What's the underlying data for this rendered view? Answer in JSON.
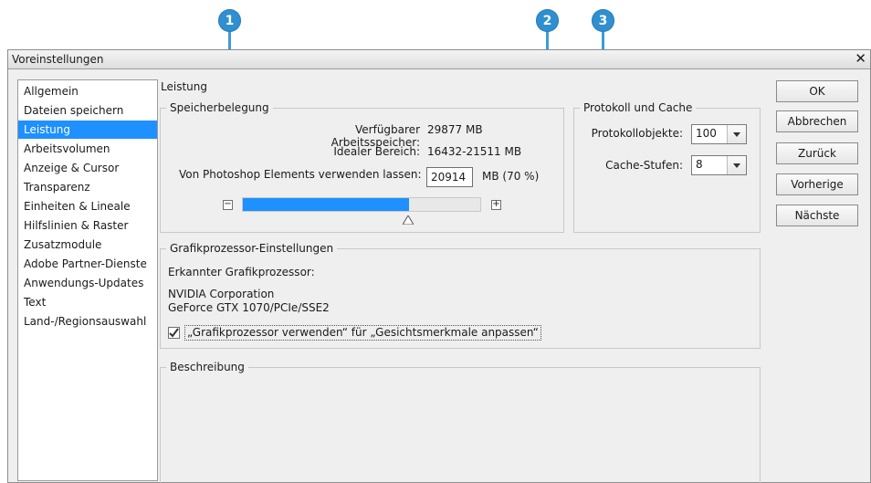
{
  "callouts": [
    "1",
    "2",
    "3"
  ],
  "window": {
    "title": "Voreinstellungen",
    "close_label": "✕"
  },
  "sidebar": {
    "items": [
      {
        "label": "Allgemein"
      },
      {
        "label": "Dateien speichern"
      },
      {
        "label": "Leistung",
        "selected": true
      },
      {
        "label": "Arbeitsvolumen"
      },
      {
        "label": "Anzeige & Cursor"
      },
      {
        "label": "Transparenz"
      },
      {
        "label": "Einheiten & Lineale"
      },
      {
        "label": "Hilfslinien & Raster"
      },
      {
        "label": "Zusatzmodule"
      },
      {
        "label": "Adobe Partner-Dienste"
      },
      {
        "label": "Anwendungs-Updates"
      },
      {
        "label": "Text"
      },
      {
        "label": "Land-/Regionsauswahl"
      }
    ]
  },
  "main": {
    "section_title": "Leistung",
    "memory": {
      "legend": "Speicherbelegung",
      "available_label": "Verfügbarer Arbeitsspeicher:",
      "available_value": "29877 MB",
      "ideal_label": "Idealer Bereich:",
      "ideal_value": "16432-21511 MB",
      "use_label": "Von Photoshop Elements verwenden lassen:",
      "use_value": "20914",
      "use_suffix": "MB (70 %)",
      "minus": "−",
      "plus": "+",
      "slider_percent": 70
    },
    "history": {
      "legend": "Protokoll und Cache",
      "states_label": "Protokollobjekte:",
      "states_value": "100",
      "cache_label": "Cache-Stufen:",
      "cache_value": "8"
    },
    "gpu": {
      "legend": "Grafikprozessor-Einstellungen",
      "detected_label": "Erkannter Grafikprozessor:",
      "vendor": "NVIDIA Corporation",
      "model": "GeForce GTX 1070/PCIe/SSE2",
      "checkbox_label": "„Grafikprozessor verwenden“ für „Gesichtsmerkmale anpassen“",
      "checkbox_checked": true
    },
    "description": {
      "legend": "Beschreibung"
    }
  },
  "buttons": {
    "ok": "OK",
    "cancel": "Abbrechen",
    "back": "Zurück",
    "previous": "Vorherige",
    "next": "Nächste"
  },
  "colors": {
    "accent": "#1e90ff",
    "callout": "#2f8fd0"
  }
}
